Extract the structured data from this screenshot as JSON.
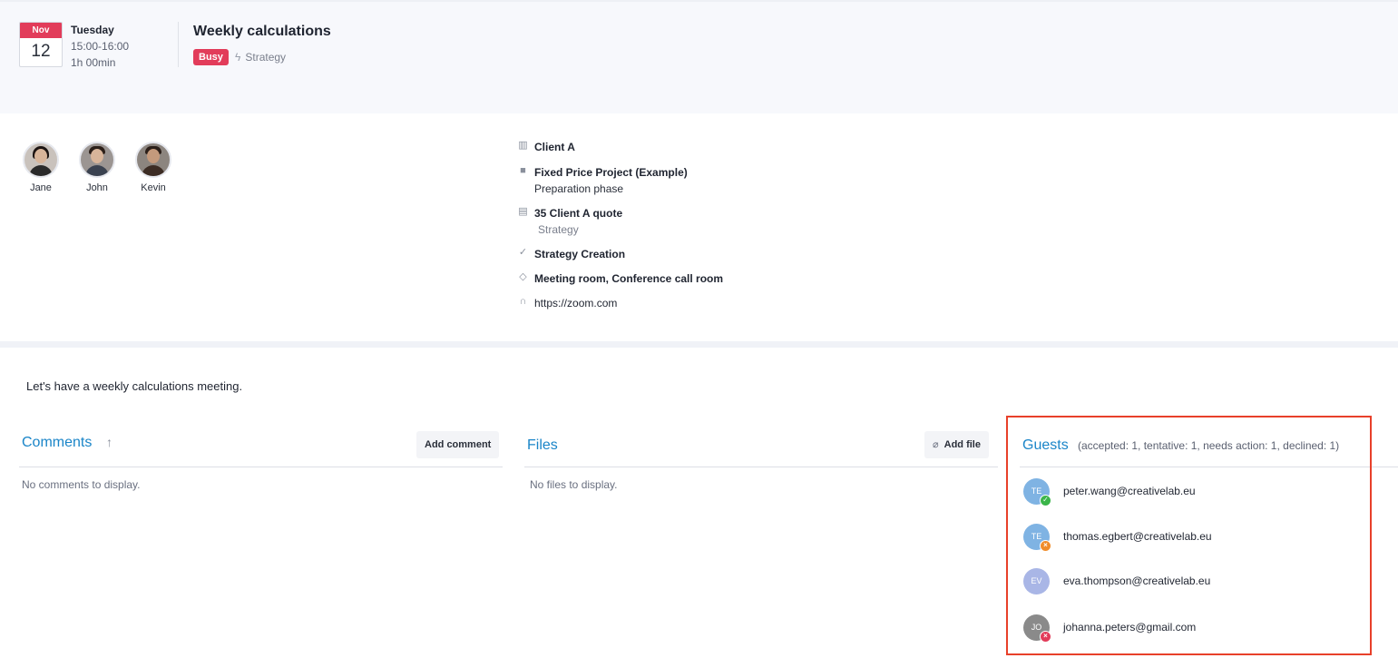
{
  "event": {
    "month": "Nov",
    "day": "12",
    "weekday": "Tuesday",
    "time_range": "15:00-16:00",
    "duration": "1h 00min",
    "title": "Weekly calculations",
    "status_badge": "Busy",
    "category": "Strategy",
    "colors": {
      "busy": "#e23c5a",
      "accent": "#1a85c8"
    }
  },
  "attendees": [
    {
      "name": "Jane"
    },
    {
      "name": "John"
    },
    {
      "name": "Kevin"
    }
  ],
  "details": {
    "client": {
      "icon": "building-icon",
      "label": "Client A"
    },
    "project": {
      "icon": "briefcase-icon",
      "label": "Fixed Price Project (Example)",
      "phase": "Preparation phase"
    },
    "quote": {
      "icon": "document-icon",
      "label": "35 Client A quote",
      "category": "Strategy"
    },
    "task": {
      "icon": "checkmark-icon",
      "label": "Strategy Creation"
    },
    "resources": {
      "icon": "cube-icon",
      "label": "Meeting room, Conference call room"
    },
    "meeting_link": {
      "icon": "headset-icon",
      "label": "https://zoom.com"
    }
  },
  "description": "Let's have a weekly calculations meeting.",
  "comments": {
    "title": "Comments",
    "add_label": "Add comment",
    "empty": "No comments to display."
  },
  "files": {
    "title": "Files",
    "add_label": "Add file",
    "empty": "No files to display."
  },
  "guests": {
    "title": "Guests",
    "summary": "(accepted: 1, tentative: 1, needs action: 1, declined: 1)",
    "items": [
      {
        "initials": "TE",
        "email": "peter.wang@creativelab.eu",
        "status": "accepted",
        "avatar_color": "#7fb3e3",
        "status_color": "#3bb54a"
      },
      {
        "initials": "TE",
        "email": "thomas.egbert@creativelab.eu",
        "status": "tentative",
        "avatar_color": "#7fb3e3",
        "status_color": "#f08c2a"
      },
      {
        "initials": "EV",
        "email": "eva.thompson@creativelab.eu",
        "status": "needs-action",
        "avatar_color": "#a9b6e6",
        "status_color": ""
      },
      {
        "initials": "JO",
        "email": "johanna.peters@gmail.com",
        "status": "declined",
        "avatar_color": "#8a8a8a",
        "status_color": "#e23c5a"
      }
    ]
  }
}
